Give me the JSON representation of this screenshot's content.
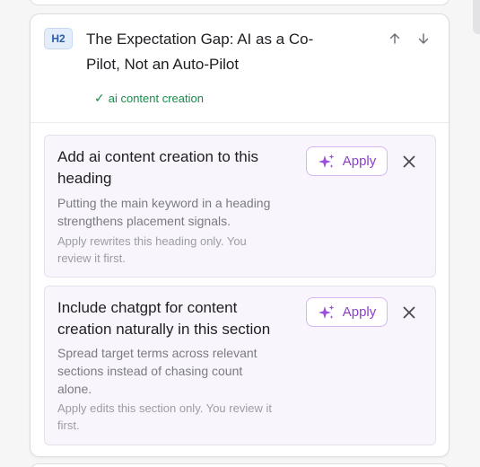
{
  "colors": {
    "accent_purple": "#8a3fc7",
    "keyword_green": "#1a8a4d",
    "badge_blue": "#2a5da8",
    "suggestion_bg": "#f9f5fc"
  },
  "section": {
    "level_badge": "H2",
    "heading_line1": "The Expectation Gap: AI as a Co-",
    "heading_line2": "Pilot, Not an Auto-Pilot",
    "move_up_icon": "arrow-up-icon",
    "move_down_icon": "arrow-down-icon",
    "keyword_check": "✓",
    "keyword": "ai content creation"
  },
  "suggestions": [
    {
      "title_line1": "Add ai content creation to this",
      "title_line2": "heading",
      "description_line1": "Putting the main keyword in a heading",
      "description_line2": "strengthens placement signals.",
      "note_line1": "Apply rewrites this heading only. You",
      "note_line2": "review it first.",
      "apply_label": "Apply",
      "apply_icon": "sparkle-icon",
      "dismiss_icon": "close-icon"
    },
    {
      "title_line1": "Include chatgpt for content",
      "title_line2": "creation naturally in this section",
      "description_line1": "Spread target terms across relevant",
      "description_line2": "sections instead of chasing count",
      "description_line3": "alone.",
      "note_line1": "Apply edits this section only. You review it",
      "note_line2": "first.",
      "apply_label": "Apply",
      "apply_icon": "sparkle-icon",
      "dismiss_icon": "close-icon"
    }
  ]
}
